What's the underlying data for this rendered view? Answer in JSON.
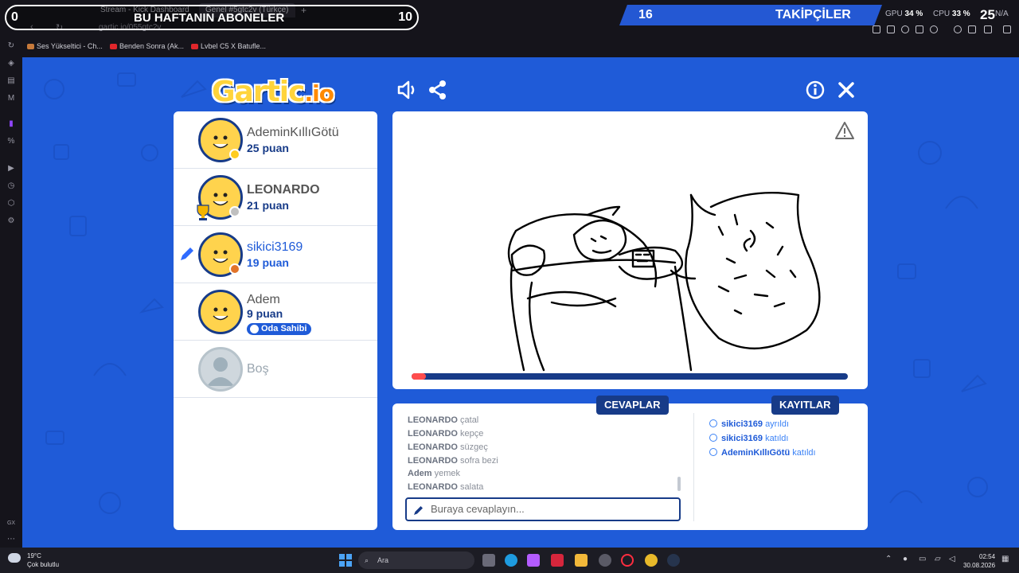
{
  "browser": {
    "tabs": [
      "Stream - Kick Dashboard",
      "Genel #5gtc2v (Türkçe)"
    ],
    "address": "gartic.io/055gtc2v",
    "bookmarks": [
      "Ses Yükseltici - Ch...",
      "Benden Sonra (Ak...",
      "Lvbel C5 X Batufle..."
    ]
  },
  "overlay": {
    "subs_left": "0",
    "subs_title": "BU HAFTANIN ABONELER",
    "subs_right": "10",
    "followers_count": "16",
    "followers_title": "TAKİPÇİLER",
    "gpu_label": "GPU",
    "gpu_value": "34 %",
    "cpu_label": "CPU",
    "cpu_value": "33 %",
    "na_value": "N/A",
    "corner_value": "25"
  },
  "game": {
    "logo_text": "Gartic",
    "logo_suffix": ".io",
    "players": [
      {
        "name": "AdeminKıllıGötü",
        "points": "25 puan",
        "badge_color": "#ffcc1f",
        "style": "bold"
      },
      {
        "name": "LEONARDO",
        "points": "21 puan",
        "badge_color": "#c0c0c0",
        "style": "bold"
      },
      {
        "name": "sikici3169",
        "points": "19 puan",
        "badge_color": "#e2742a",
        "style": "blue"
      },
      {
        "name": "Adem",
        "points": "9 puan",
        "owner_label": "Oda Sahibi",
        "style": "normal"
      },
      {
        "name": "Boş",
        "style": "empty"
      }
    ],
    "timer_fraction": 0.03,
    "answers_title": "CEVAPLAR",
    "logs_title": "KAYITLAR",
    "answers": [
      {
        "user": "LEONARDO",
        "text": "çatal"
      },
      {
        "user": "LEONARDO",
        "text": "kepçe"
      },
      {
        "user": "LEONARDO",
        "text": "süzgeç"
      },
      {
        "user": "LEONARDO",
        "text": "sofra bezi"
      },
      {
        "user": "Adem",
        "text": "yemek"
      },
      {
        "user": "LEONARDO",
        "text": "salata"
      }
    ],
    "answer_placeholder": "Buraya cevaplayın...",
    "logs": [
      {
        "user": "sikici3169",
        "text": "ayrıldı"
      },
      {
        "user": "sikici3169",
        "text": "katıldı"
      },
      {
        "user": "AdeminKıllıGötü",
        "text": "katıldı"
      }
    ]
  },
  "taskbar": {
    "weather_temp": "19°C",
    "weather_desc": "Çok bulutlu",
    "search_label": "Ara",
    "time": "02:54",
    "date": "30.08.2026"
  },
  "colors": {
    "page_bg": "#1f5bd8",
    "accent_dark": "#173b88",
    "timer_fill": "#ff4d4d"
  }
}
